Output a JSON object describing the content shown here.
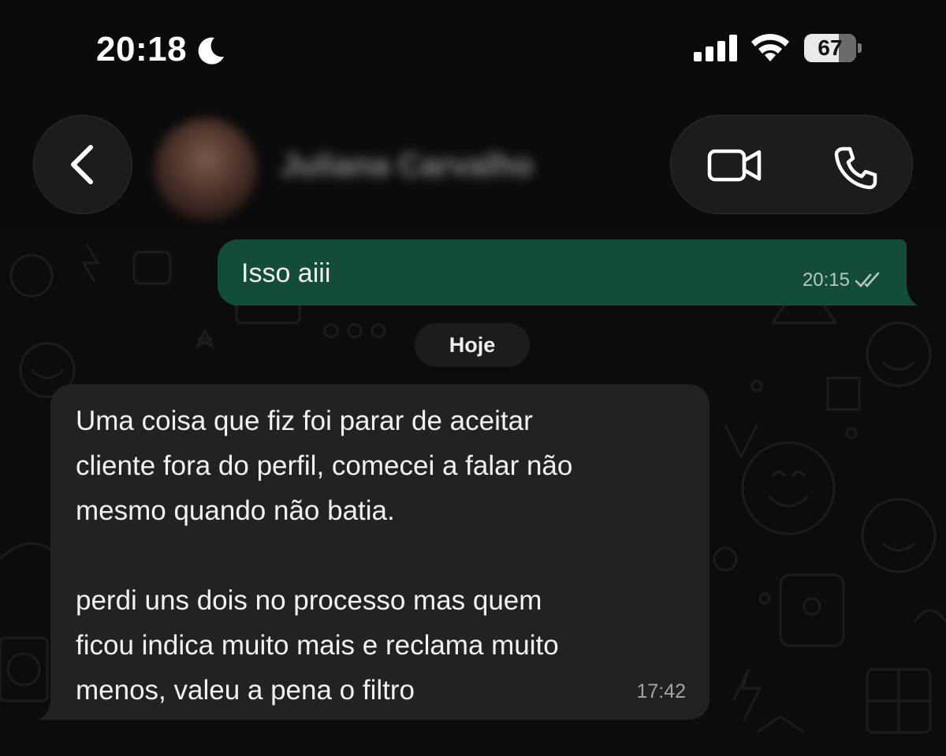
{
  "status_bar": {
    "time": "20:18",
    "focus_icon": "moon-icon",
    "signal_icon": "cellular-signal-icon",
    "wifi_icon": "wifi-icon",
    "battery_level": "67",
    "battery_fraction": 0.67
  },
  "header": {
    "back_icon": "chevron-left-icon",
    "contact_name": "Juliana Carvalho",
    "video_call_icon": "video-camera-icon",
    "voice_call_icon": "phone-icon"
  },
  "messages": [
    {
      "direction": "outgoing",
      "text": "Isso aiii",
      "time": "20:15",
      "status_icon": "double-check-icon"
    }
  ],
  "date_separator": "Hoje",
  "incoming_message": {
    "lines": [
      "Uma coisa que fiz foi parar de aceitar",
      "cliente fora do perfil, comecei a falar não",
      "mesmo quando não batia.",
      "",
      "perdi uns dois no processo mas quem",
      "ficou indica muito mais e reclama muito",
      "menos, valeu a pena o filtro"
    ],
    "time": "17:42"
  },
  "colors": {
    "background": "#0b0b0b",
    "outgoing_bubble": "#144d37",
    "incoming_bubble": "#222224",
    "header_button": "#1c1c1e"
  }
}
